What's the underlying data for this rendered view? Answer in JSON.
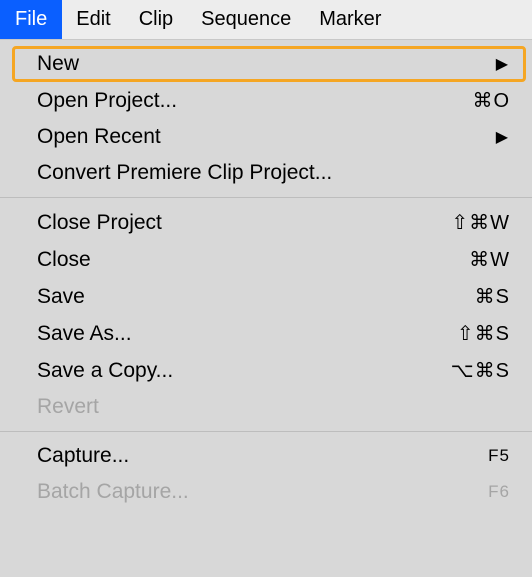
{
  "menubar": {
    "items": [
      {
        "label": "File"
      },
      {
        "label": "Edit"
      },
      {
        "label": "Clip"
      },
      {
        "label": "Sequence"
      },
      {
        "label": "Marker"
      }
    ]
  },
  "dropdown": {
    "groups": [
      {
        "items": [
          {
            "label": "New",
            "hasSubmenu": true,
            "highlighted": true
          },
          {
            "label": "Open Project...",
            "shortcut": "⌘O"
          },
          {
            "label": "Open Recent",
            "hasSubmenu": true
          },
          {
            "label": "Convert Premiere Clip Project..."
          }
        ]
      },
      {
        "items": [
          {
            "label": "Close Project",
            "shortcut": "⇧⌘W"
          },
          {
            "label": "Close",
            "shortcut": "⌘W"
          },
          {
            "label": "Save",
            "shortcut": "⌘S"
          },
          {
            "label": "Save As...",
            "shortcut": "⇧⌘S"
          },
          {
            "label": "Save a Copy...",
            "shortcut": "⌥⌘S"
          },
          {
            "label": "Revert",
            "disabled": true
          }
        ]
      },
      {
        "items": [
          {
            "label": "Capture...",
            "shortcut": "F5",
            "fkey": true
          },
          {
            "label": "Batch Capture...",
            "shortcut": "F6",
            "fkey": true,
            "disabled": true
          }
        ]
      }
    ]
  }
}
